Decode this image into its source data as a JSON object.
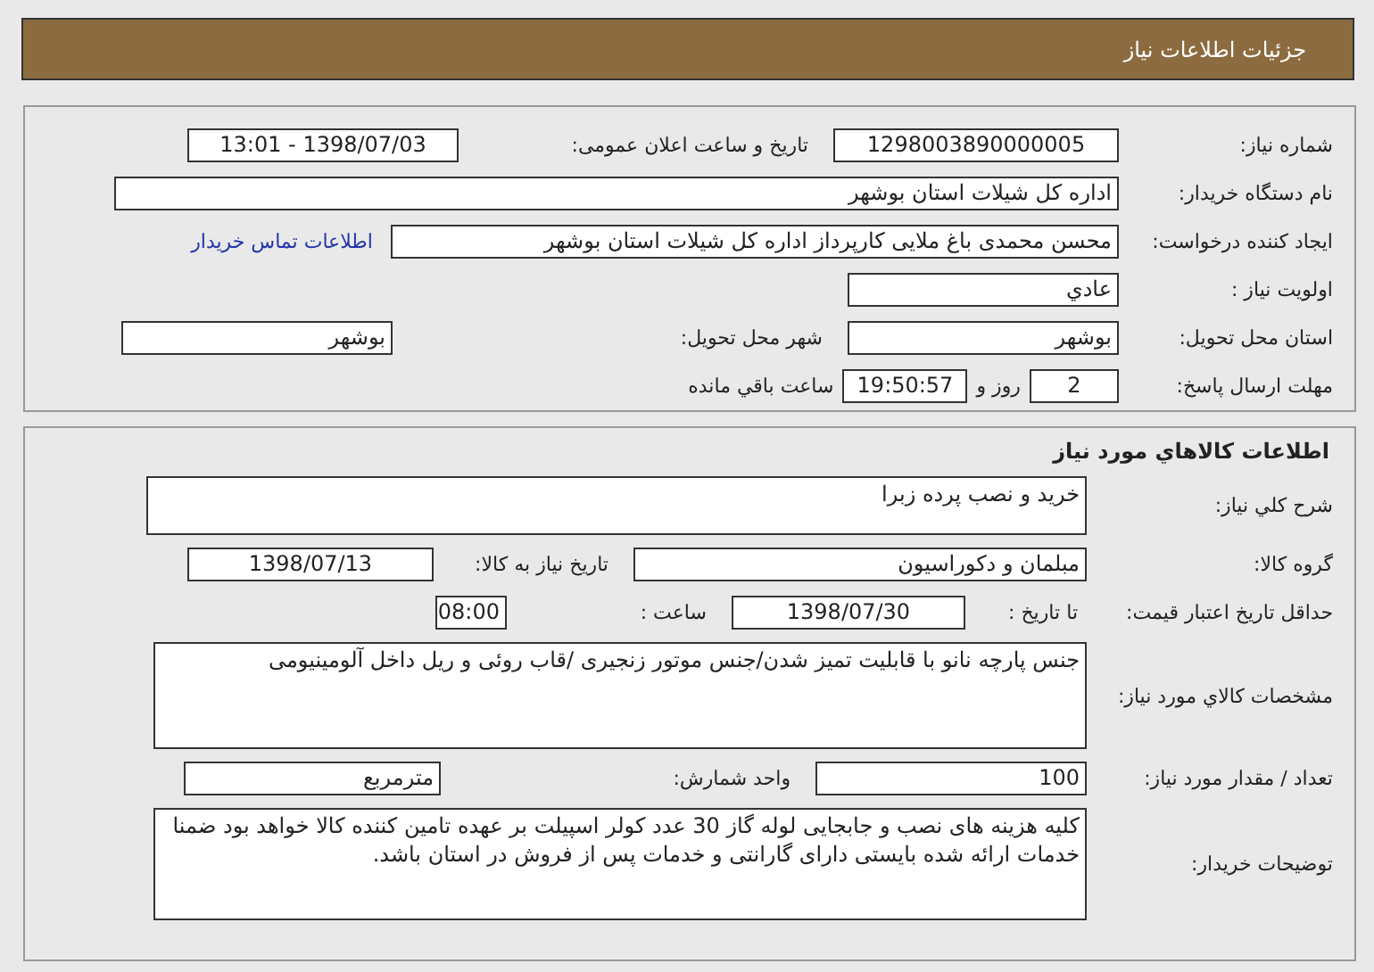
{
  "header": {
    "title": "جزئیات اطلاعات نیاز"
  },
  "need": {
    "number": {
      "label": "شماره نیاز:",
      "value": "1298003890000005"
    },
    "announce": {
      "label": "تاریخ و ساعت اعلان عمومی:",
      "value": "1398/07/03 - 13:01"
    },
    "buyer": {
      "label": "نام دستگاه خریدار:",
      "value": "اداره کل شیلات استان بوشهر"
    },
    "creator": {
      "label": "ایجاد کننده درخواست:",
      "value": "محسن محمدی باغ ملایی کارپرداز اداره کل شیلات استان بوشهر",
      "link": "اطلاعات تماس خریدار"
    },
    "priority": {
      "label": "اولویت نیاز :",
      "value": "عادي"
    },
    "province": {
      "label": "استان محل تحویل:",
      "value": "بوشهر"
    },
    "city": {
      "label": "شهر محل تحویل:",
      "value": "بوشهر"
    },
    "deadline": {
      "label": "مهلت ارسال پاسخ:",
      "days": "2",
      "days_text": "روز و",
      "time": "19:50:57",
      "time_text": "ساعت باقي مانده"
    }
  },
  "goods": {
    "title": "اطلاعات كالاهاي مورد نياز",
    "summary": {
      "label": "شرح کلي نياز:",
      "value": "خرید و نصب پرده زبرا"
    },
    "group": {
      "label": "گروه کالا:",
      "value": "مبلمان و دکوراسیون"
    },
    "need_date": {
      "label": "تاریخ نیاز به کالا:",
      "value": "1398/07/13"
    },
    "validity": {
      "label": "حداقل تاریخ اعتبار قیمت:",
      "to_label": "تا تاریخ :",
      "date": "1398/07/30",
      "time_label": "ساعت :",
      "time": "08:00"
    },
    "specs": {
      "label": "مشخصات کالاي مورد نياز:",
      "value": "جنس پارچه نانو با قابلیت تمیز شدن/جنس موتور زنجیری /قاب روئی و ریل داخل آلومینیومی"
    },
    "quantity": {
      "label": "تعداد / مقدار مورد نیاز:",
      "value": "100"
    },
    "unit": {
      "label": "واحد شمارش:",
      "value": "مترمربع"
    },
    "notes": {
      "label": "توضیحات خریدار:",
      "value": "کلیه هزینه های نصب و جابجایی لوله گاز 30 عدد کولر اسپیلت بر عهده تامین کننده کالا خواهد بود ضمنا خدمات ارائه شده بایستی دارای گارانتی و خدمات پس از فروش در استان باشد."
    }
  }
}
